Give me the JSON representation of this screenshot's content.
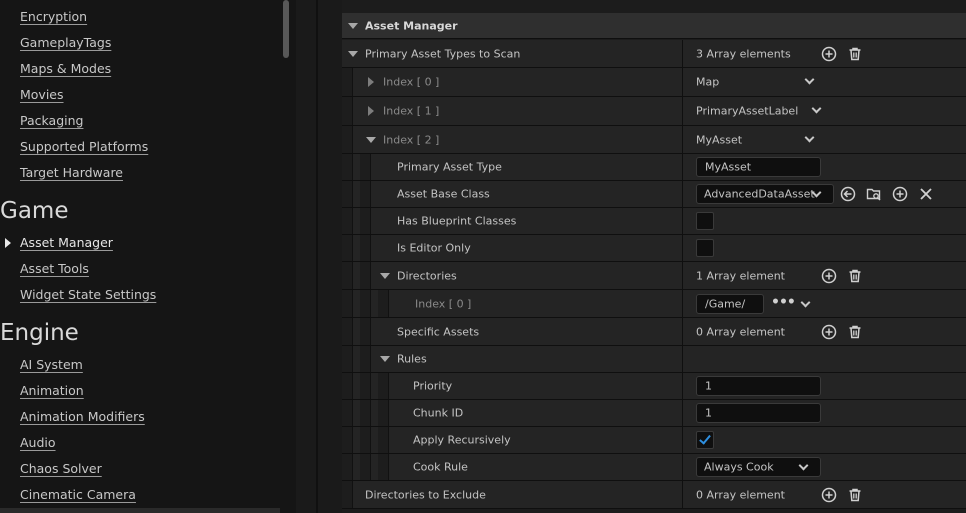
{
  "sidebar": {
    "top_links": [
      "Encryption",
      "GameplayTags",
      "Maps & Modes",
      "Movies",
      "Packaging",
      "Supported Platforms",
      "Target Hardware"
    ],
    "game_category": "Game",
    "game_links": [
      "Asset Manager",
      "Asset Tools",
      "Widget State Settings"
    ],
    "engine_category": "Engine",
    "engine_links": [
      "AI System",
      "Animation",
      "Animation Modifiers",
      "Audio",
      "Chaos Solver",
      "Cinematic Camera"
    ]
  },
  "details": {
    "category": "Asset Manager",
    "primary_asset_types": {
      "label": "Primary Asset Types to Scan",
      "count": "3 Array elements",
      "index0": {
        "label": "Index [ 0 ]",
        "value": "Map"
      },
      "index1": {
        "label": "Index [ 1 ]",
        "value": "PrimaryAssetLabel"
      },
      "index2": {
        "label": "Index [ 2 ]",
        "value": "MyAsset"
      }
    },
    "primary_asset_type": {
      "label": "Primary Asset Type",
      "value": "MyAsset"
    },
    "asset_base_class": {
      "label": "Asset Base Class",
      "value": "AdvancedDataAsset"
    },
    "has_blueprint_classes": {
      "label": "Has Blueprint Classes",
      "checked": false
    },
    "is_editor_only": {
      "label": "Is Editor Only",
      "checked": false
    },
    "directories": {
      "label": "Directories",
      "count": "1 Array element",
      "index0_label": "Index [ 0 ]",
      "index0_value": "/Game/"
    },
    "specific_assets": {
      "label": "Specific Assets",
      "count": "0 Array element"
    },
    "rules": {
      "label": "Rules",
      "priority": {
        "label": "Priority",
        "value": "1"
      },
      "chunk_id": {
        "label": "Chunk ID",
        "value": "1"
      },
      "apply_recursively": {
        "label": "Apply Recursively",
        "checked": true
      },
      "cook_rule": {
        "label": "Cook Rule",
        "value": "Always Cook"
      }
    },
    "directories_to_exclude": {
      "label": "Directories to Exclude",
      "count": "0 Array element"
    }
  },
  "icons": {
    "add": "plus-circle-icon",
    "remove": "trash-icon",
    "use_selected": "arrow-left-circle-icon",
    "browse": "folder-search-icon",
    "clear": "x-icon",
    "more": "ellipsis-icon"
  },
  "colors": {
    "accent": "#2e8fe0",
    "panel": "#242424",
    "header": "#2f2f2f"
  }
}
